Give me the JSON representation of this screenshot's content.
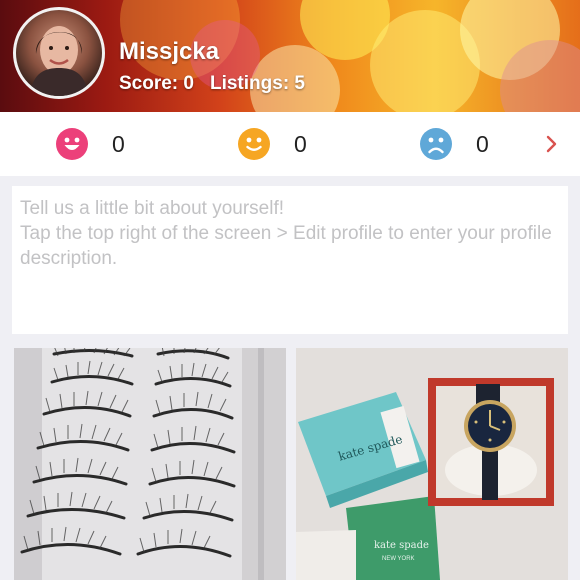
{
  "profile": {
    "username": "Missjcka",
    "score_text": "Score: 0",
    "listings_text": "Listings: 5"
  },
  "ratings": [
    {
      "type": "positive",
      "count": "0",
      "color": "#ec407a"
    },
    {
      "type": "neutral",
      "count": "0",
      "color": "#f6a623"
    },
    {
      "type": "negative",
      "count": "0",
      "color": "#5fa8d8"
    }
  ],
  "about": {
    "placeholder_line1": "Tell us a little bit about yourself!",
    "placeholder_line2": "Tap the top right of the screen > Edit profile to enter your profile description."
  },
  "listings": [
    {
      "image": "false-eyelashes-photo"
    },
    {
      "image": "kate-spade-watch-photo",
      "brand_text": "kate spade",
      "city_text": "NEW YORK"
    }
  ]
}
